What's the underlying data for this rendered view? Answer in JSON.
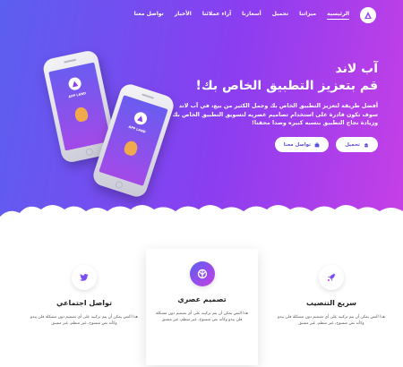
{
  "nav": {
    "logo_icon": "triangle-a-logo",
    "items": [
      {
        "label": "الرئيسية",
        "active": true
      },
      {
        "label": "ميزاتنا"
      },
      {
        "label": "تحميل"
      },
      {
        "label": "أسعارنا"
      },
      {
        "label": "آراء عملائنا"
      },
      {
        "label": "الأخبار"
      },
      {
        "label": "تواصل معنا"
      }
    ]
  },
  "hero": {
    "title_line1": "آب لاند",
    "title_line2": "قم بتعزيز التطبيق الخاص بك!",
    "description": "أفضل طريقة لتعزيز التطبيق الخاص بك وجمل الكثير من بيع، في آب لاند سوف تكون قادرة على استخدام تصاميم عصريه لتسويق التطبيق الخاص بك وزيادة نجاح التطبيق بنسبه كبيره وصدا محقنا!",
    "btn_download": "تحميل",
    "btn_contact": "تواصل معنا",
    "phone_label": "APP LAND"
  },
  "features": [
    {
      "title": "سريع التنصيب",
      "icon": "rocket-icon",
      "text": "هذا النص يمكن أن يتم تركيبه على أي تصميم دون مشكلة فلن يبدو وكأنه نص منسوخ، غير منظم، غير منسق"
    },
    {
      "title": "تصميم عصري",
      "icon": "rebel-logo-icon",
      "text": "هذا النص يمكن أن يتم تركيبه على أي تصميم دون مشكلة فلن يبدو وكأنه نص منسوخ، غير منظم، غير منسق"
    },
    {
      "title": "تواصل اجتماعي",
      "icon": "twitter-bird-icon",
      "text": "هذا النص يمكن أن يتم تركيبه على أي تصميم دون مشكلة فلن يبدو وكأنه نص منسوخ، غير منظم، غير منسق"
    }
  ],
  "colors": {
    "gradient_start": "#5b5ff0",
    "gradient_end": "#c63fe6",
    "accent": "#7b4ef0"
  }
}
